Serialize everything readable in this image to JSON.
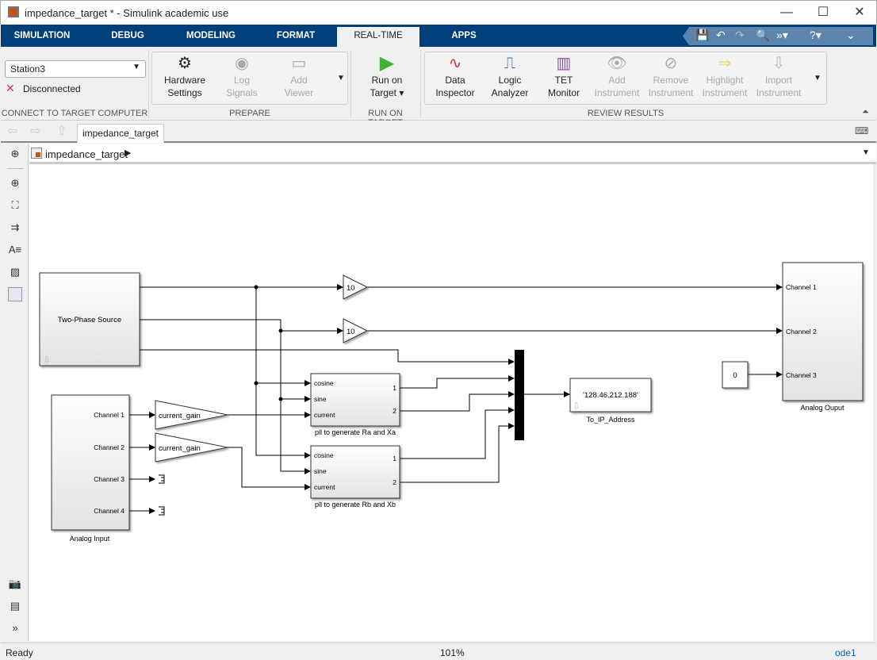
{
  "window": {
    "title": "impedance_target * - Simulink academic use",
    "minimize": "—",
    "maximize": "☐",
    "close": "✕"
  },
  "tabs": [
    {
      "label": "SIMULATION"
    },
    {
      "label": "DEBUG"
    },
    {
      "label": "MODELING"
    },
    {
      "label": "FORMAT"
    },
    {
      "label": "REAL-TIME",
      "active": true
    },
    {
      "label": "APPS"
    }
  ],
  "ribbon": {
    "connect": {
      "target": "Station3",
      "status": "Disconnected",
      "group_label": "CONNECT TO TARGET COMPUTER"
    },
    "prepare": {
      "buttons": [
        {
          "line1": "Hardware",
          "line2": "Settings",
          "enabled": true
        },
        {
          "line1": "Log",
          "line2": "Signals",
          "enabled": false
        },
        {
          "line1": "Add",
          "line2": "Viewer",
          "enabled": false
        }
      ],
      "group_label": "PREPARE"
    },
    "run": {
      "line1": "Run on",
      "line2": "Target",
      "group_label": "RUN ON TARGET"
    },
    "review": {
      "buttons": [
        {
          "line1": "Data",
          "line2": "Inspector",
          "enabled": true
        },
        {
          "line1": "Logic",
          "line2": "Analyzer",
          "enabled": true
        },
        {
          "line1": "TET",
          "line2": "Monitor",
          "enabled": true
        },
        {
          "line1": "Add",
          "line2": "Instrument",
          "enabled": false
        },
        {
          "line1": "Remove",
          "line2": "Instrument",
          "enabled": false
        },
        {
          "line1": "Highlight",
          "line2": "Instrument",
          "enabled": false
        },
        {
          "line1": "Import",
          "line2": "Instrument",
          "enabled": false
        }
      ],
      "group_label": "REVIEW RESULTS"
    }
  },
  "document_tab": "impedance_target",
  "breadcrumb": "impedance_target",
  "diagram": {
    "two_phase_source": "Two-Phase Source",
    "gain_top": "10",
    "gain_mid": "10",
    "analog_input": {
      "label": "Analog Input",
      "ports": [
        "Channel 1",
        "Channel 2",
        "Channel 3",
        "Channel 4"
      ]
    },
    "gain1": "current_gain",
    "gain2": "current_gain",
    "pll_a": {
      "label": "pll to generate Ra and Xa",
      "inputs": [
        "cosine",
        "sine",
        "current"
      ],
      "outputs": [
        "1",
        "2"
      ]
    },
    "pll_b": {
      "label": "pll to generate Rb and Xb",
      "inputs": [
        "cosine",
        "sine",
        "current"
      ],
      "outputs": [
        "1",
        "2"
      ]
    },
    "to_ip": {
      "value": "'128.46.212.188'",
      "label": "To_IP_Address"
    },
    "constant": "0",
    "analog_output": {
      "label": "Analog Ouput",
      "ports": [
        "Channel 1",
        "Channel 2",
        "Channel 3"
      ]
    }
  },
  "status": {
    "left": "Ready",
    "zoom": "101%",
    "solver": "ode1"
  },
  "colors": {
    "tab_bar": "#003f7a",
    "run_green": "#3cb531"
  }
}
